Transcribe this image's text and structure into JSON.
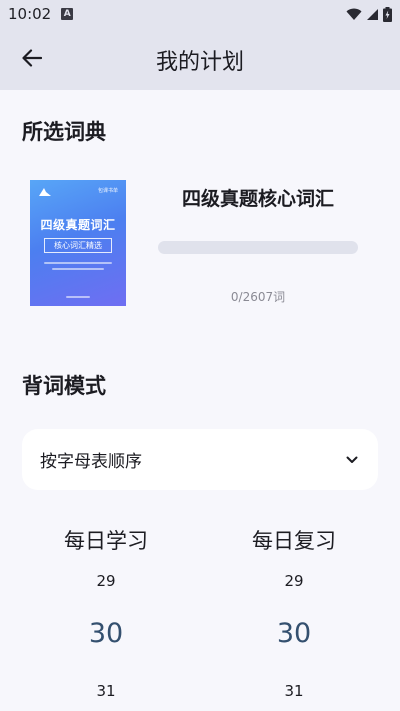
{
  "status_bar": {
    "time": "10:02",
    "notification_letter": "A"
  },
  "app_bar": {
    "title": "我的计划"
  },
  "selected_dictionary": {
    "section_title": "所选词典",
    "book_name": "四级真题核心词汇",
    "progress_text": "0/2607词",
    "progress_learned": 0,
    "progress_total": 2607,
    "cover": {
      "brand": "包课书单",
      "title": "四级真题词汇",
      "subtitle": "核心词汇精选"
    }
  },
  "study_mode": {
    "section_title": "背词模式",
    "selected": "按字母表顺序"
  },
  "pickers": {
    "daily_learn": {
      "label": "每日学习",
      "prev": "29",
      "current": "30",
      "next": "31"
    },
    "daily_review": {
      "label": "每日复习",
      "prev": "29",
      "current": "30",
      "next": "31"
    }
  },
  "colors": {
    "app_bar_bg": "#e3e4ee",
    "page_bg": "#f7f7fc",
    "accent": "#34506f",
    "progress_track": "#e0e2ec"
  }
}
